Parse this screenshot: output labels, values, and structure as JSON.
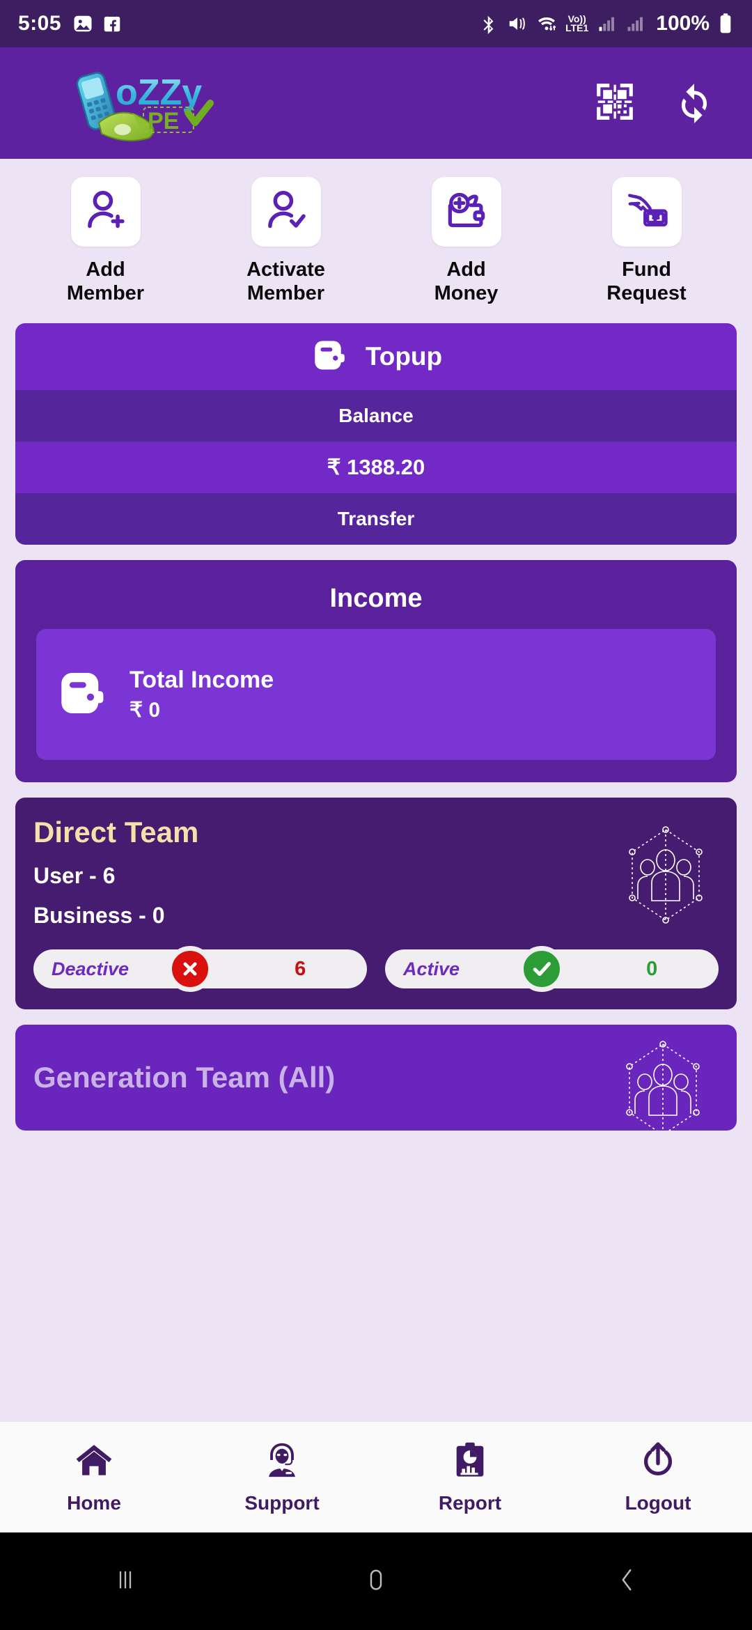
{
  "statusbar": {
    "time": "5:05",
    "battery_percent": "100%",
    "network_label_top": "Vo))",
    "network_label_bottom": "LTE1",
    "icons": [
      "photos-icon",
      "facebook-icon",
      "bluetooth-icon",
      "mute-icon",
      "wifi-icon",
      "volte-icon",
      "signal-sim1-icon",
      "signal-sim2-icon",
      "battery-icon"
    ]
  },
  "appbar": {
    "logo_text_primary": "oZZy",
    "logo_text_secondary": "PE",
    "qr_label": "qr-scanner",
    "refresh_label": "refresh"
  },
  "quick_actions": [
    {
      "label": "Add\nMember",
      "line1": "Add",
      "line2": "Member",
      "icon": "user-add-icon"
    },
    {
      "label": "Activate Member",
      "line1": "Activate",
      "line2": "Member",
      "icon": "user-check-icon"
    },
    {
      "label": "Add Money",
      "line1": "Add",
      "line2": "Money",
      "icon": "wallet-plus-icon"
    },
    {
      "label": "Fund Request",
      "line1": "Fund",
      "line2": "Request",
      "icon": "hand-cash-icon"
    }
  ],
  "topup": {
    "title": "Topup",
    "icon": "wallet-icon",
    "balance_label": "Balance",
    "balance_amount": "₹ 1388.20",
    "transfer_label": "Transfer"
  },
  "income": {
    "title": "Income",
    "panel_label": "Total Income",
    "panel_value": "₹ 0",
    "icon": "wallet-icon"
  },
  "direct_team": {
    "title": "Direct Team",
    "user_line": "User - 6",
    "business_line": "Business - 0",
    "art_icon": "team-network-icon",
    "deactive": {
      "label": "Deactive",
      "count": "6",
      "icon": "cross-circle-icon",
      "color": "#D8100E"
    },
    "active": {
      "label": "Active",
      "count": "0",
      "icon": "check-circle-icon",
      "color": "#2C9C36"
    }
  },
  "generation_team": {
    "title": "Generation Team (All)",
    "art_icon": "team-network-icon"
  },
  "bottom_nav": [
    {
      "label": "Home",
      "icon": "home-icon"
    },
    {
      "label": "Support",
      "icon": "headset-agent-icon"
    },
    {
      "label": "Report",
      "icon": "clipboard-chart-icon"
    },
    {
      "label": "Logout",
      "icon": "power-logout-icon"
    }
  ],
  "system_nav": [
    {
      "name": "recents",
      "icon": "recents-icon"
    },
    {
      "name": "home",
      "icon": "home-pill-icon"
    },
    {
      "name": "back",
      "icon": "back-chevron-icon"
    }
  ],
  "colors": {
    "status_bar": "#3D1F61",
    "app_bar": "#5E22A0",
    "page_bg": "#ECE4F5",
    "card_purple": "#7229C6",
    "card_purple_dark": "#55259B",
    "income_bg": "#5B219D",
    "income_panel": "#7B35D4",
    "direct_team_bg": "#451C70",
    "generation_team_bg": "#6A25BC",
    "accent_gold": "#F6DFA9",
    "nav_text": "#401B63"
  }
}
